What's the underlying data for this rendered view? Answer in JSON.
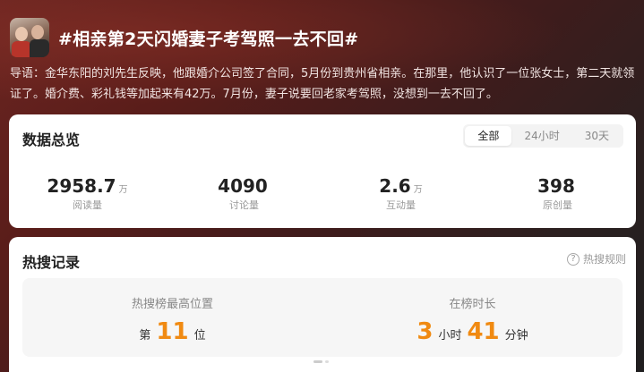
{
  "topic": {
    "title": "#相亲第2天闪婚妻子考驾照一去不回#",
    "intro": "导语：金华东阳的刘先生反映，他跟婚介公司签了合同，5月份到贵州省相亲。在那里，他认识了一位张女士，第二天就领证了。婚介费、彩礼钱等加起来有42万。7月份，妻子说要回老家考驾照，没想到一去不回了。"
  },
  "overview": {
    "title": "数据总览",
    "tabs": [
      {
        "label": "全部",
        "active": true
      },
      {
        "label": "24小时",
        "active": false
      },
      {
        "label": "30天",
        "active": false
      }
    ],
    "stats": [
      {
        "value": "2958.7",
        "unit": "万",
        "label": "阅读量"
      },
      {
        "value": "4090",
        "unit": "",
        "label": "讨论量"
      },
      {
        "value": "2.6",
        "unit": "万",
        "label": "互动量"
      },
      {
        "value": "398",
        "unit": "",
        "label": "原创量"
      }
    ]
  },
  "hot": {
    "title": "热搜记录",
    "rules_label": "热搜规则",
    "rules_icon": "question-circle-icon",
    "peak": {
      "label": "热搜榜最高位置",
      "prefix": "第",
      "value": "11",
      "suffix": "位"
    },
    "duration": {
      "label": "在榜时长",
      "hours": "3",
      "hours_unit": "小时",
      "minutes": "41",
      "minutes_unit": "分钟"
    }
  },
  "colors": {
    "accent_orange": "#f08a12",
    "header_bg": "#5a1d1a"
  }
}
